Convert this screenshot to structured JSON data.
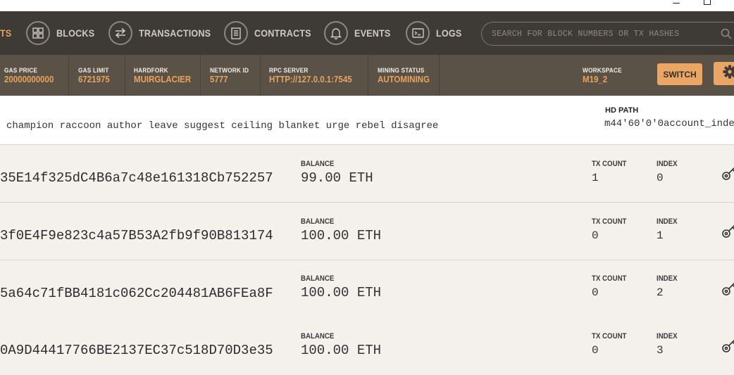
{
  "nav": {
    "items": [
      {
        "label": "TS",
        "icon": "accounts-icon",
        "active": true
      },
      {
        "label": "BLOCKS",
        "icon": "blocks-icon"
      },
      {
        "label": "TRANSACTIONS",
        "icon": "transactions-icon"
      },
      {
        "label": "CONTRACTS",
        "icon": "contracts-icon"
      },
      {
        "label": "EVENTS",
        "icon": "bell-icon"
      },
      {
        "label": "LOGS",
        "icon": "terminal-icon"
      }
    ],
    "search_placeholder": "SEARCH FOR BLOCK NUMBERS OR TX HASHES"
  },
  "status": {
    "gas_price": {
      "label": "GAS PRICE",
      "value": "20000000000"
    },
    "gas_limit": {
      "label": "GAS LIMIT",
      "value": "6721975"
    },
    "hardfork": {
      "label": "HARDFORK",
      "value": "MUIRGLACIER"
    },
    "network_id": {
      "label": "NETWORK ID",
      "value": "5777"
    },
    "rpc_server": {
      "label": "RPC SERVER",
      "value": "HTTP://127.0.0.1:7545"
    },
    "mining_status": {
      "label": "MINING STATUS",
      "value": "AUTOMINING"
    },
    "workspace": {
      "label": "WORKSPACE",
      "value": "M19_2"
    },
    "switch_label": "SWITCH"
  },
  "mnemonic": {
    "words": "champion raccoon author leave suggest ceiling blanket urge rebel disagree",
    "hd_label": "HD PATH",
    "hd_value": "m44'60'0'0account_inde"
  },
  "labels": {
    "balance": "BALANCE",
    "tx_count": "TX COUNT",
    "index": "INDEX"
  },
  "accounts": [
    {
      "address": "35E14f325dC4B6a7c48e161318Cb752257",
      "balance": "99.00 ETH",
      "tx_count": "1",
      "index": "0"
    },
    {
      "address": "3f0E4F9e823c4a57B53A2fb9f90B813174",
      "balance": "100.00 ETH",
      "tx_count": "0",
      "index": "1"
    },
    {
      "address": "5a64c71fBB4181c062Cc204481AB6FEa8F",
      "balance": "100.00 ETH",
      "tx_count": "0",
      "index": "2"
    },
    {
      "address": "0A9D44417766BE2137EC37c518D70D3e35",
      "balance": "100.00 ETH",
      "tx_count": "0",
      "index": "3"
    }
  ],
  "colors": {
    "accent": "#e9a664",
    "nav_bg": "#3e3a36",
    "status_bg": "#5a5147"
  }
}
